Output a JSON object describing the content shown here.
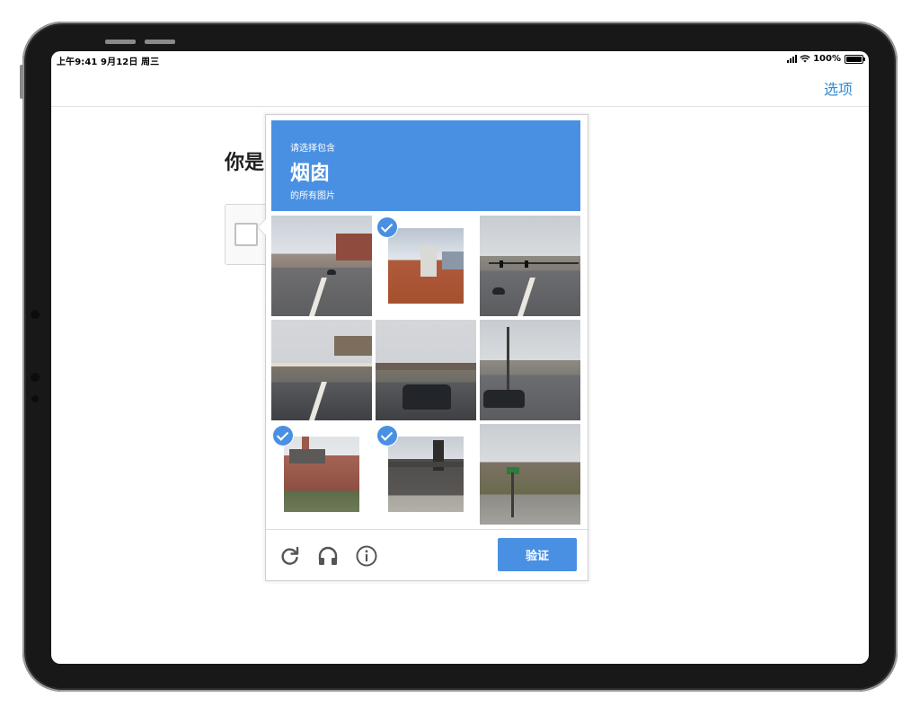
{
  "status_bar": {
    "time_date": "上午9:41  9月12日 周三",
    "battery": "100%"
  },
  "nav": {
    "options_label": "选项"
  },
  "page": {
    "heading": "你是"
  },
  "challenge": {
    "prompt_pre": "请选择包含",
    "prompt_target": "烟囱",
    "prompt_post": "的所有图片",
    "verify_label": "验证",
    "tiles": [
      {
        "scene": "street-intersection",
        "selected": false
      },
      {
        "scene": "chimney-roof",
        "selected": true
      },
      {
        "scene": "traffic-lights",
        "selected": false
      },
      {
        "scene": "highway",
        "selected": false
      },
      {
        "scene": "car-overpass",
        "selected": false
      },
      {
        "scene": "truck-street",
        "selected": false
      },
      {
        "scene": "brick-house",
        "selected": true
      },
      {
        "scene": "grey-house-chimney",
        "selected": true
      },
      {
        "scene": "trees-street-sign",
        "selected": false
      }
    ]
  },
  "icons": {
    "reload": "reload-icon",
    "audio": "headphones-icon",
    "info": "info-icon",
    "check": "check-icon"
  },
  "colors": {
    "accent_blue": "#4a90e2",
    "link_blue": "#2e8bd6",
    "frame": "#181818"
  }
}
